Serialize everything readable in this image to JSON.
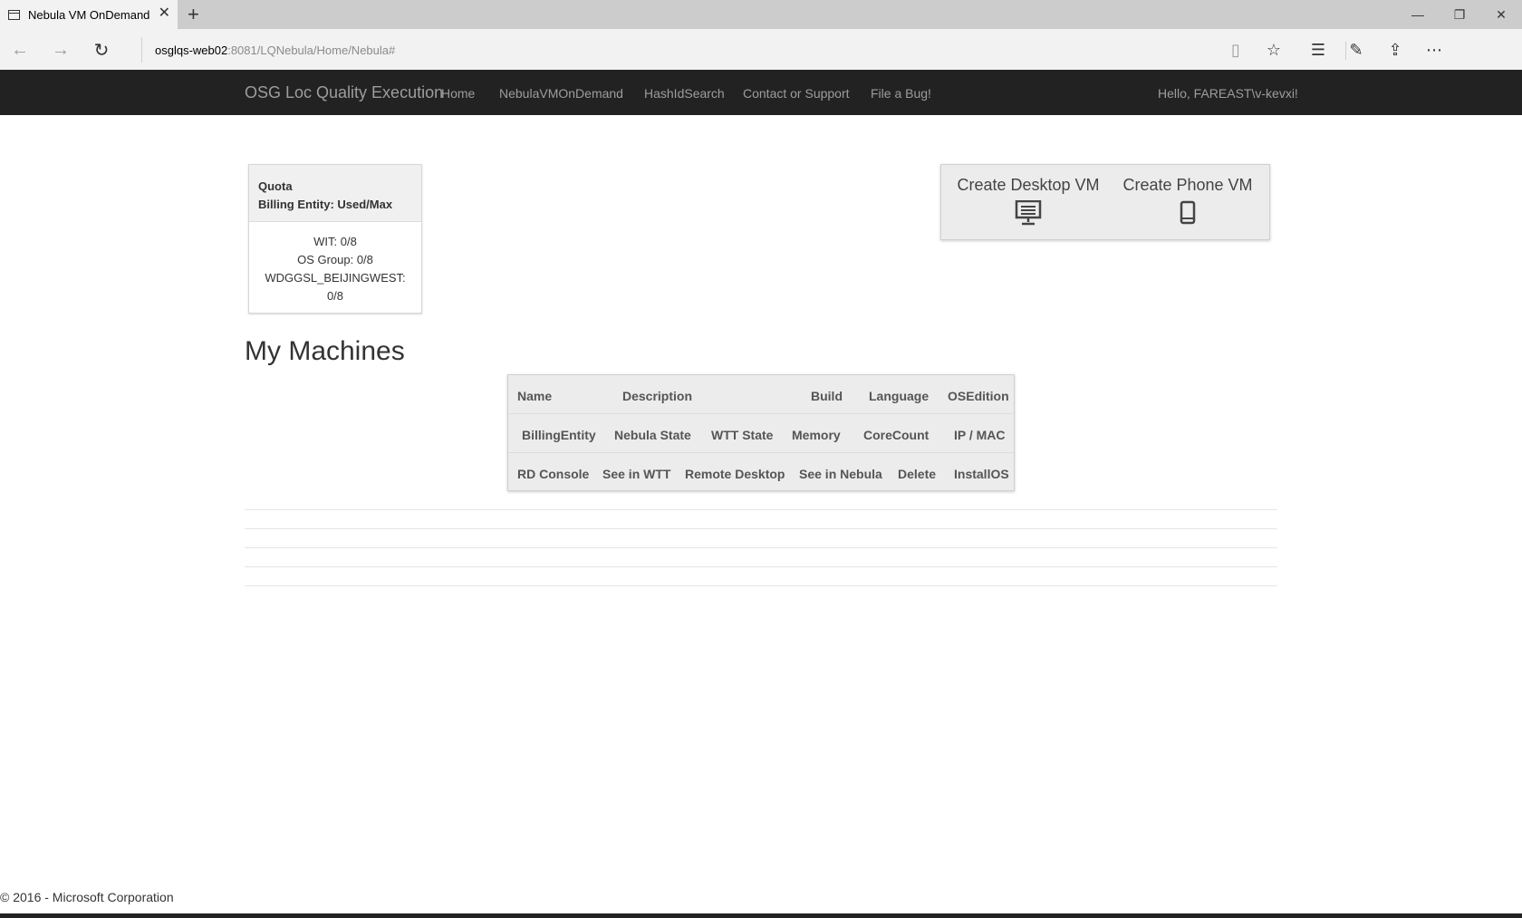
{
  "browser": {
    "tab_title": "Nebula VM OnDemand",
    "url_host": "osglqs-web02",
    "url_path": ":8081/LQNebula/Home/Nebula#"
  },
  "navbar": {
    "brand": "OSG Loc Quality Execution",
    "links": [
      "Home",
      "NebulaVMOnDemand",
      "HashIdSearch",
      "Contact or Support",
      "File a Bug!"
    ],
    "greeting": "Hello, FAREAST\\v-kevxi!"
  },
  "quota": {
    "title": "Quota",
    "subtitle": "Billing Entity: Used/Max",
    "lines": [
      "WIT: 0/8",
      "OS Group: 0/8",
      "WDGGSL_BEIJINGWEST:",
      "0/8"
    ]
  },
  "create": {
    "desktop_label": "Create Desktop VM",
    "phone_label": "Create Phone VM"
  },
  "machines": {
    "heading": "My Machines",
    "row1": [
      "Name",
      "Description",
      "Build",
      "Language",
      "OSEdition"
    ],
    "row2": [
      "BillingEntity",
      "Nebula State",
      "WTT State",
      "Memory",
      "CoreCount",
      "IP / MAC"
    ],
    "row3": [
      "RD Console",
      "See in WTT",
      "Remote Desktop",
      "See in Nebula",
      "Delete",
      "InstallOS"
    ]
  },
  "footer": "© 2016 - Microsoft Corporation"
}
